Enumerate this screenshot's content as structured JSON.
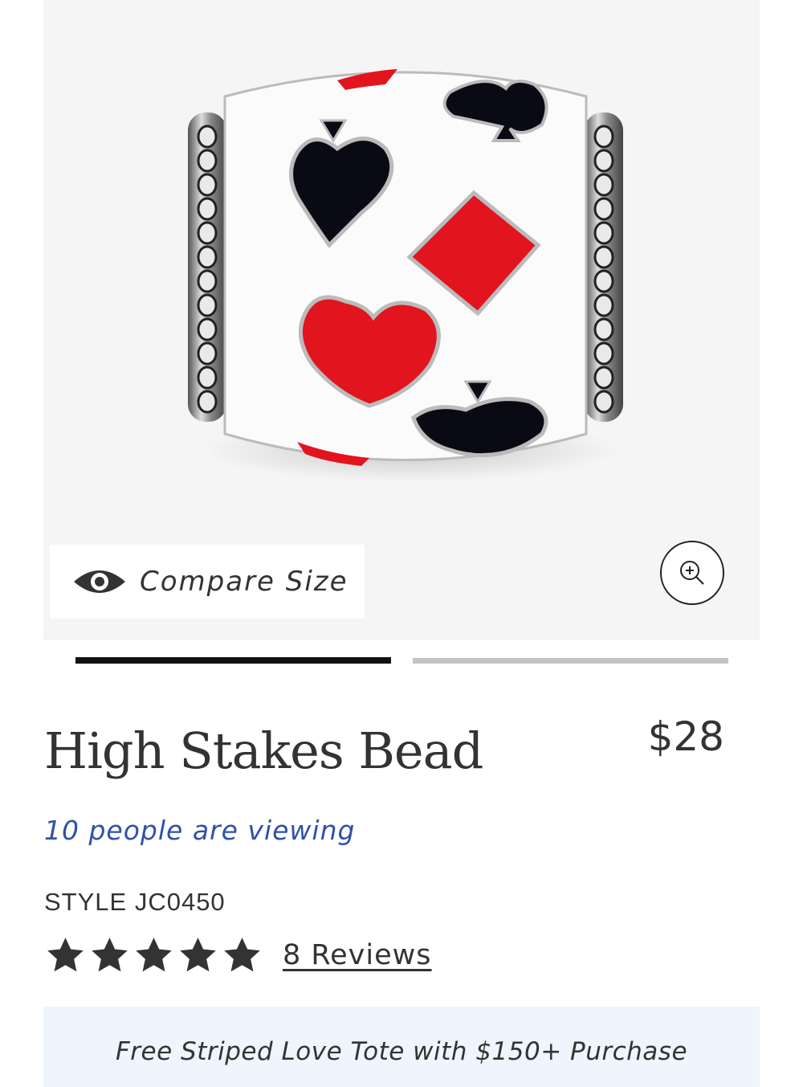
{
  "gallery": {
    "image_alt": "High Stakes Bead",
    "compare_label": "Compare Size",
    "compare_icon": "eye-icon",
    "zoom_icon": "zoom-in-icon",
    "slides_total": 2,
    "slide_active": 1
  },
  "product": {
    "title": "High Stakes Bead",
    "price": "$28",
    "viewing_text": "10 people are viewing",
    "style_code": "STYLE JC0450",
    "rating": 5,
    "rating_max": 5,
    "reviews_label": "8 Reviews"
  },
  "promo": {
    "text": "Free Striped Love Tote with $150+ Purchase"
  },
  "colors": {
    "link_blue": "#2f51a8",
    "promo_bg": "#eef5fc",
    "enamel_red": "#e2141e",
    "enamel_black": "#0a0a14"
  }
}
